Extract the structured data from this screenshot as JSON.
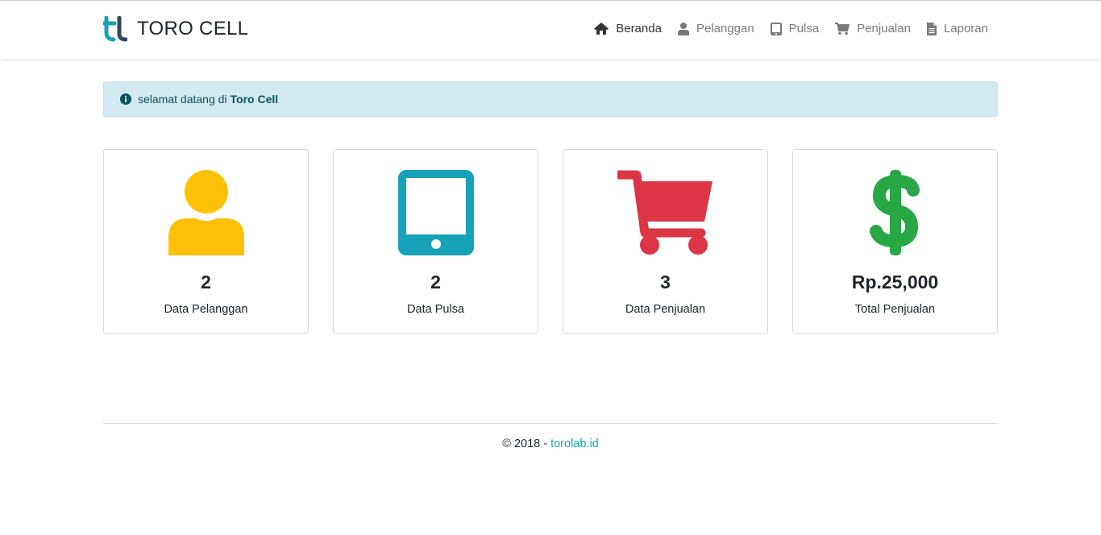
{
  "brand": {
    "logo_icon": "toro-logo-icon",
    "name": "TORO CELL"
  },
  "nav": {
    "items": [
      {
        "icon": "home-icon",
        "label": "Beranda",
        "active": true
      },
      {
        "icon": "user-icon",
        "label": "Pelanggan",
        "active": false
      },
      {
        "icon": "tablet-icon",
        "label": "Pulsa",
        "active": false
      },
      {
        "icon": "cart-icon",
        "label": "Penjualan",
        "active": false
      },
      {
        "icon": "file-icon",
        "label": "Laporan",
        "active": false
      }
    ]
  },
  "alert": {
    "icon": "info-circle-icon",
    "text": "selamat datang di",
    "highlight": "Toro Cell"
  },
  "cards": [
    {
      "icon": "user-icon",
      "color": "#ffc107",
      "value": "2",
      "label": "Data Pelanggan"
    },
    {
      "icon": "tablet-icon",
      "color": "#17a2b8",
      "value": "2",
      "label": "Data Pulsa"
    },
    {
      "icon": "cart-icon",
      "color": "#dc3545",
      "value": "3",
      "label": "Data Penjualan"
    },
    {
      "icon": "dollar-icon",
      "color": "#28a745",
      "value": "Rp.25,000",
      "label": "Total Penjualan"
    }
  ],
  "footer": {
    "copyright": "© 2018 - ",
    "link": "torolab.id"
  },
  "colors": {
    "accent": "#17a2b8",
    "alert_bg": "#d1e9ef",
    "alert_text": "#0c5460"
  }
}
